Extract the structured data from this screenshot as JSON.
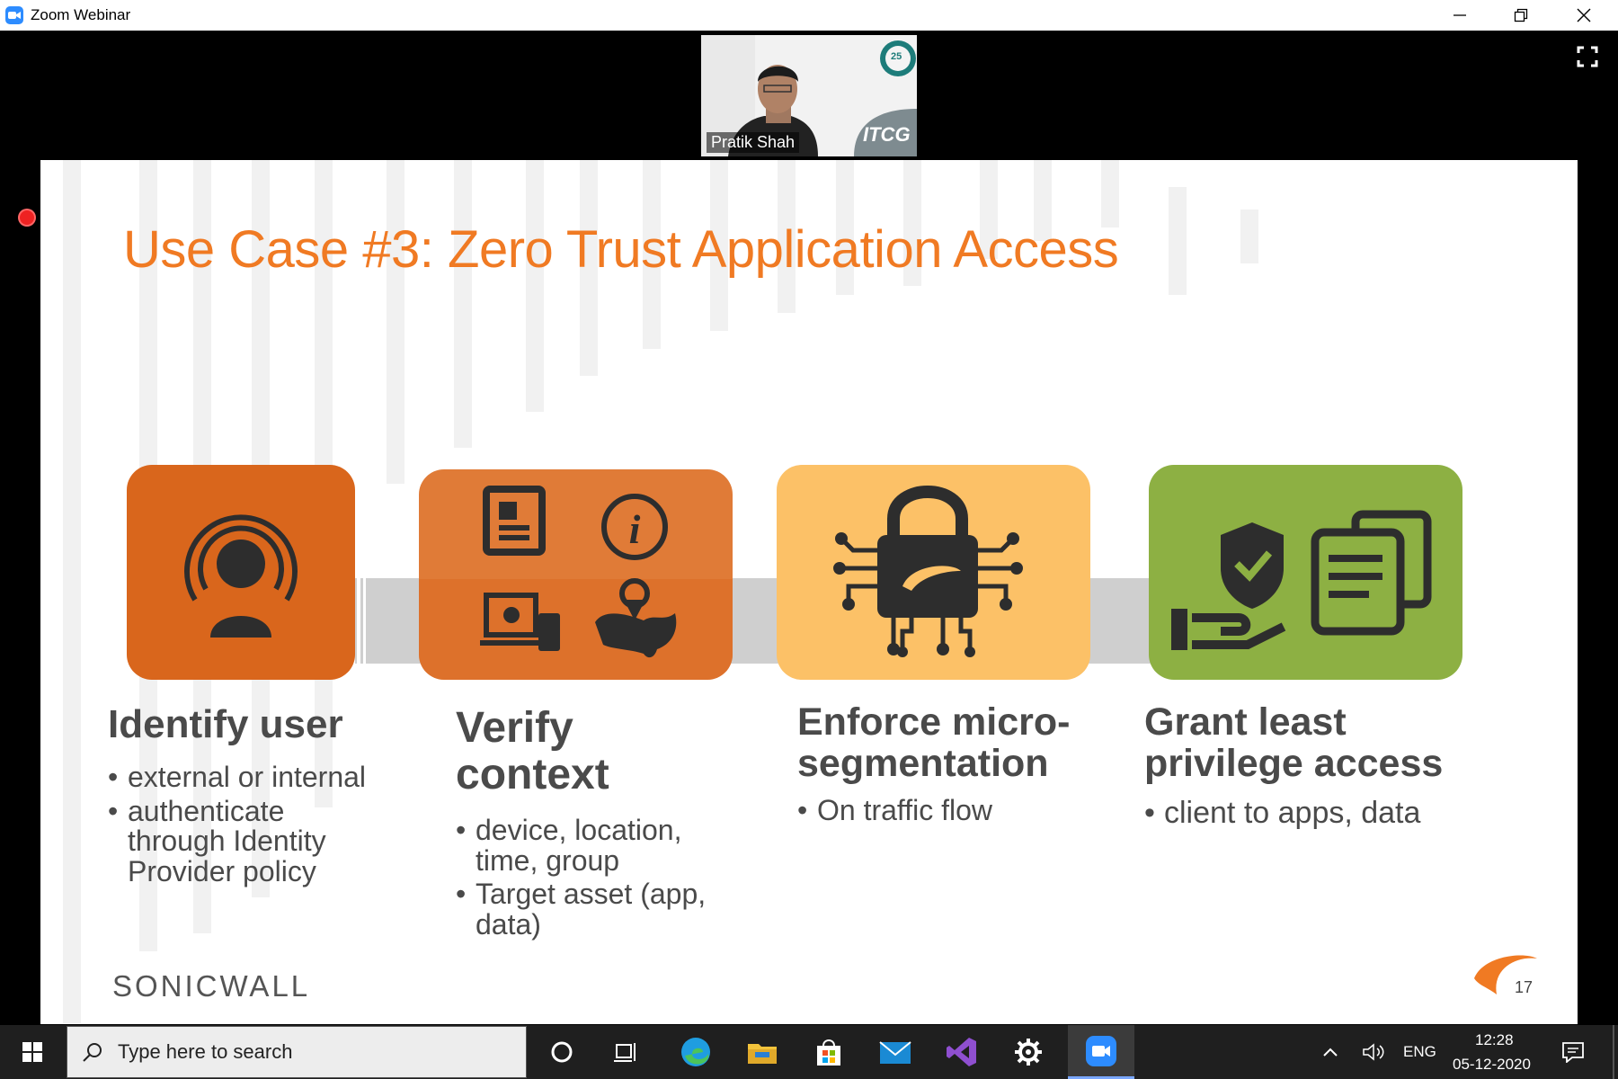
{
  "window": {
    "title": "Zoom Webinar"
  },
  "video": {
    "participant_name": "Pratik Shah",
    "logo_text": "ITCG",
    "badge_number": "25"
  },
  "slide": {
    "title": "Use Case #3: Zero Trust Application Access",
    "steps": [
      {
        "heading_lines": [
          "Identify user"
        ],
        "bullets": [
          "external or internal",
          "authenticate through Identity Provider policy"
        ],
        "color": "#d9661c"
      },
      {
        "heading_lines": [
          "Verify",
          "context"
        ],
        "bullets": [
          "device, location, time, group",
          "Target asset (app, data)"
        ],
        "color": "#e07b37"
      },
      {
        "heading_lines": [
          "Enforce micro-",
          "segmentation"
        ],
        "bullets": [
          "On traffic flow"
        ],
        "color": "#fcc167"
      },
      {
        "heading_lines": [
          "Grant least",
          "privilege access"
        ],
        "bullets": [
          "client to apps, data"
        ],
        "color": "#8db043"
      }
    ],
    "logo": "SONICWALL",
    "page_number": "17"
  },
  "taskbar": {
    "search_placeholder": "Type here to search",
    "language": "ENG",
    "time": "12:28",
    "date": "05-12-2020"
  }
}
